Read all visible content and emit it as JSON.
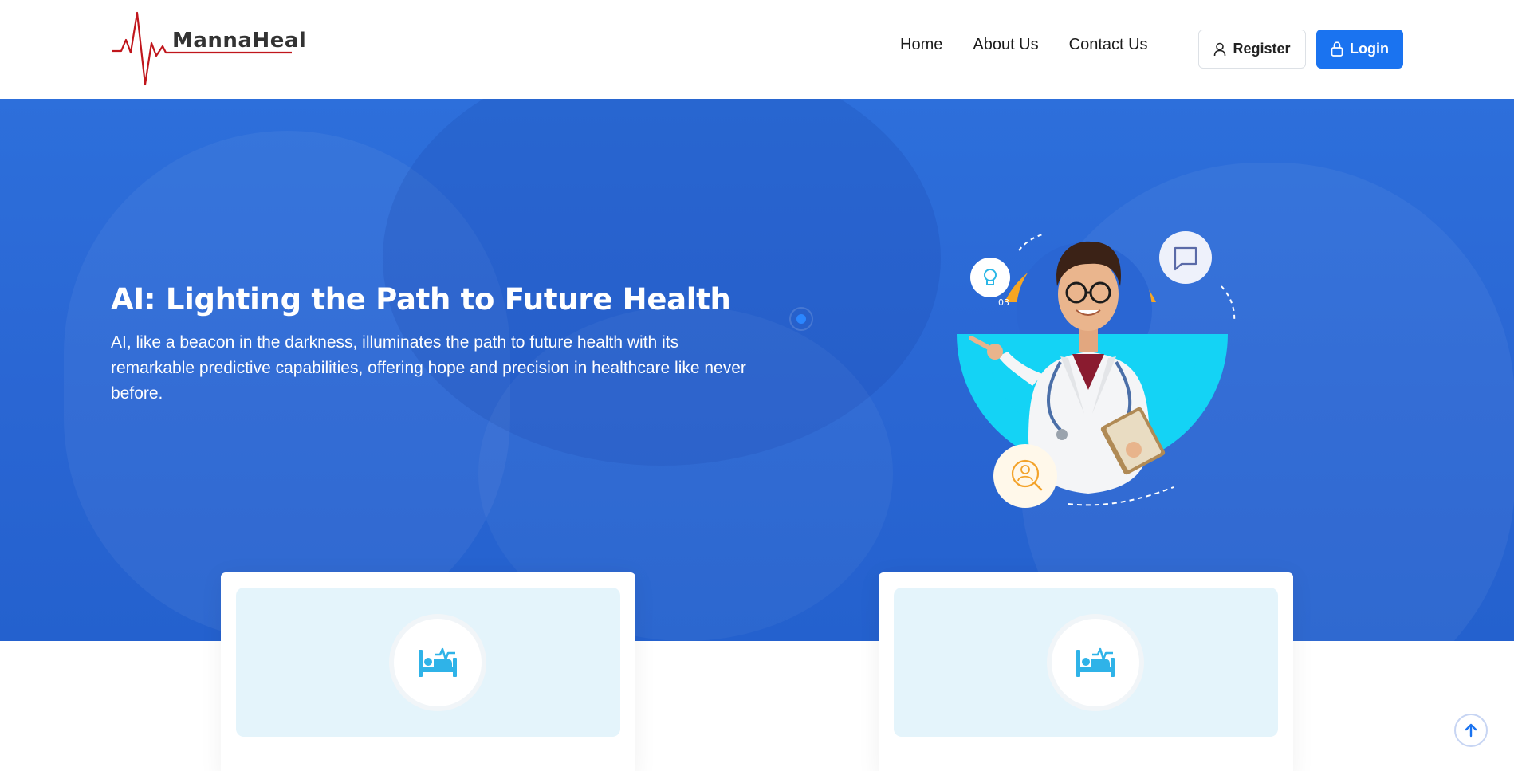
{
  "brand": {
    "name": "MannaHeal",
    "accent": "#1a73f0",
    "logo_line_color": "#c0161c"
  },
  "nav": {
    "items": [
      {
        "label": "Home"
      },
      {
        "label": "About Us"
      },
      {
        "label": "Contact Us"
      }
    ],
    "register_label": "Register",
    "login_label": "Login"
  },
  "hero": {
    "title": "AI: Lighting the Path to Future Health",
    "text": "AI, like a beacon in the darkness, illuminates the path to future health with its remarkable predictive capabilities, offering hope and precision in healthcare like never before.",
    "badge_number": "03",
    "background_color": "#2a66d3"
  },
  "cards": [
    {
      "icon": "hospital-bed-icon"
    },
    {
      "icon": "hospital-bed-icon"
    }
  ],
  "icons": {
    "register": "user-icon",
    "login": "lock-icon",
    "scroll_top": "arrow-up-icon"
  }
}
